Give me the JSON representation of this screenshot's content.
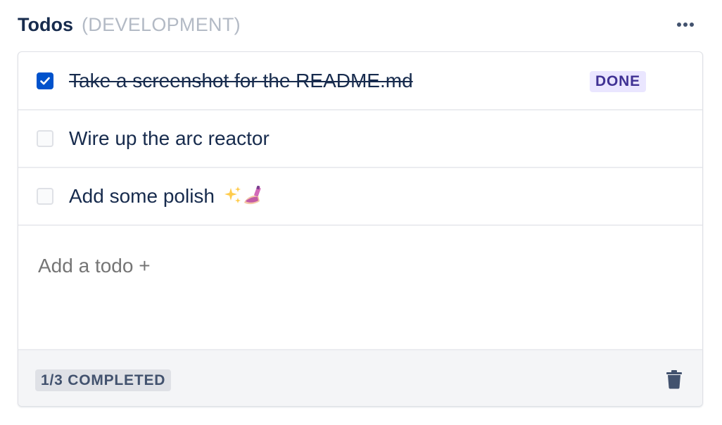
{
  "header": {
    "title": "Todos",
    "environment": "(DEVELOPMENT)",
    "more_icon": "more-horizontal-icon"
  },
  "todos": [
    {
      "text": "Take a screenshot for the README.md",
      "completed": true,
      "badge": "DONE"
    },
    {
      "text": "Wire up the arc reactor",
      "completed": false
    },
    {
      "text": "Add some polish ",
      "completed": false,
      "emoji": "sparkles-and-nail-polish"
    }
  ],
  "add_todo": {
    "placeholder": "Add a todo +"
  },
  "footer": {
    "completed_label": "1/3 COMPLETED",
    "trash_icon": "trash-icon"
  },
  "colors": {
    "accent": "#0052cc",
    "done_badge_bg": "#eae6ff",
    "done_badge_text": "#403294",
    "text": "#172b4d",
    "muted": "#b3bac5"
  }
}
